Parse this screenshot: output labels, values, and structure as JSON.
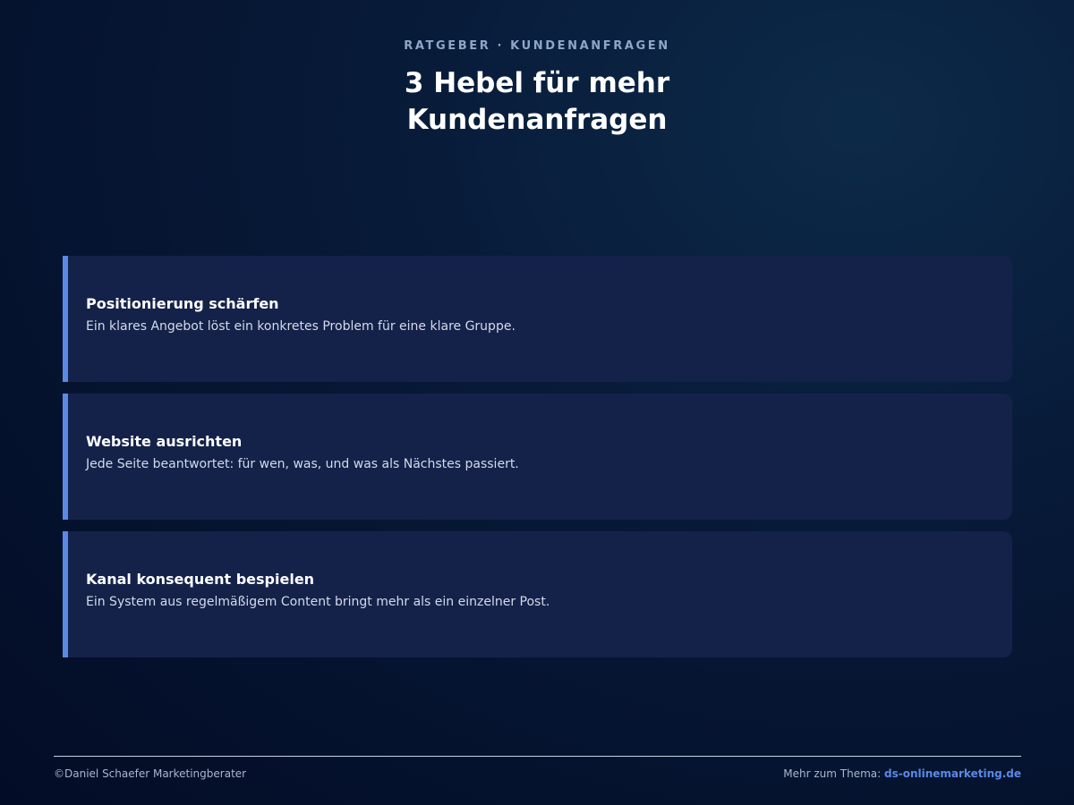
{
  "header": {
    "kicker": "RATGEBER · KUNDENANFRAGEN",
    "title": "3 Hebel für mehr Kundenanfragen"
  },
  "cards": [
    {
      "title": "Positionierung schärfen",
      "text": "Ein klares Angebot löst ein konkretes Problem für eine klare Gruppe."
    },
    {
      "title": "Website ausrichten",
      "text": "Jede Seite beantwortet: für wen, was, und was als Nächstes passiert."
    },
    {
      "title": "Kanal konsequent bespielen",
      "text": "Ein System aus regelmäßigem Content bringt mehr als ein einzelner Post."
    }
  ],
  "footer": {
    "copyright": "©Daniel Schaefer Marketingberater",
    "more_label": "Mehr zum Thema: ",
    "link_text": "ds-onlinemarketing.de"
  },
  "colors": {
    "accent": "#5a8ae6",
    "card_bg": "#14224a",
    "kicker": "#8fa7c7"
  }
}
